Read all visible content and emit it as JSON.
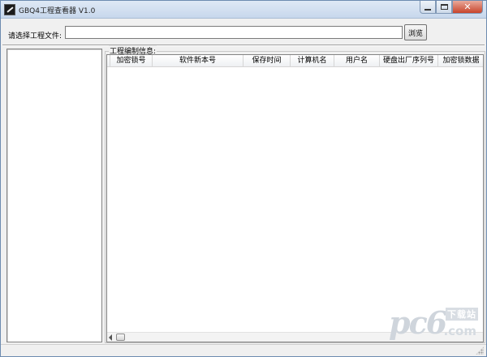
{
  "window": {
    "title": "GBQ4工程查看器 V1.0",
    "controls": {
      "minimize": "minimize",
      "maximize": "maximize",
      "close": "close"
    }
  },
  "file_select": {
    "label": "请选择工程文件:",
    "value": "",
    "browse_label": "浏览"
  },
  "info_group": {
    "title": "工程编制信息:",
    "columns": [
      {
        "label": "加密锁号"
      },
      {
        "label": "软件新本号"
      },
      {
        "label": "保存时间"
      },
      {
        "label": "计算机名"
      },
      {
        "label": "用户名"
      },
      {
        "label": "硬盘出厂序列号"
      },
      {
        "label": "加密锁数据"
      }
    ],
    "rows": []
  },
  "watermark": {
    "brand": "pc6",
    "tag": "下载站",
    "domain": ".com"
  },
  "colors": {
    "titlebar": "#c7d7ec",
    "background": "#f0f0f0",
    "close_button": "#c8442b"
  }
}
